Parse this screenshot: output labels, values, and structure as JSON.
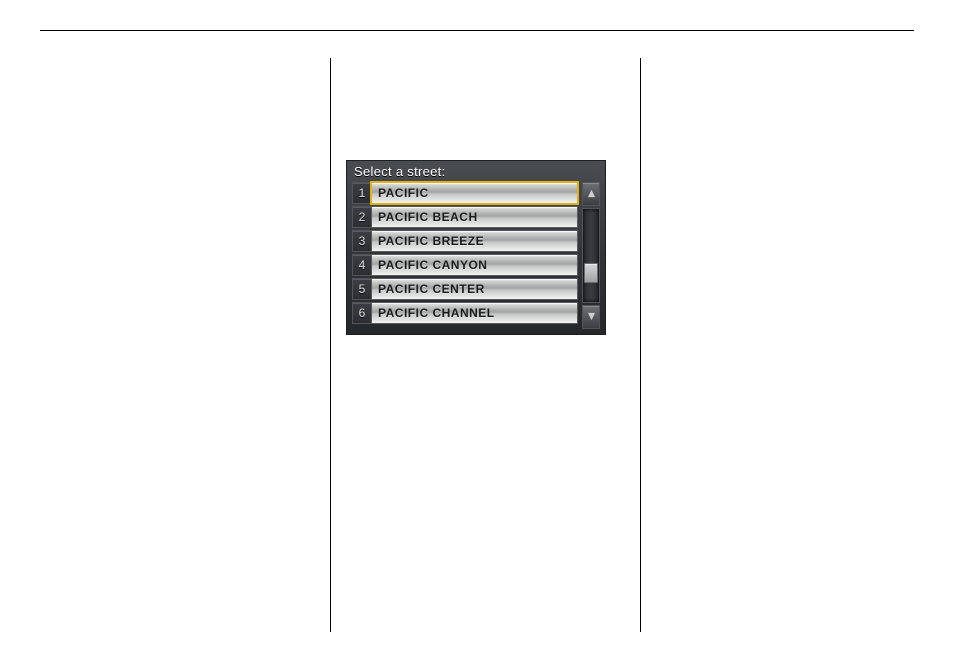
{
  "nav": {
    "title": "Select a street:",
    "items": [
      {
        "num": "1",
        "label": "PACIFIC",
        "selected": true
      },
      {
        "num": "2",
        "label": "PACIFIC BEACH",
        "selected": false
      },
      {
        "num": "3",
        "label": "PACIFIC BREEZE",
        "selected": false
      },
      {
        "num": "4",
        "label": "PACIFIC CANYON",
        "selected": false
      },
      {
        "num": "5",
        "label": "PACIFIC CENTER",
        "selected": false
      },
      {
        "num": "6",
        "label": "PACIFIC CHANNEL",
        "selected": false
      }
    ],
    "scroll": {
      "up_icon": "triangle-up",
      "down_icon": "triangle-down"
    }
  }
}
